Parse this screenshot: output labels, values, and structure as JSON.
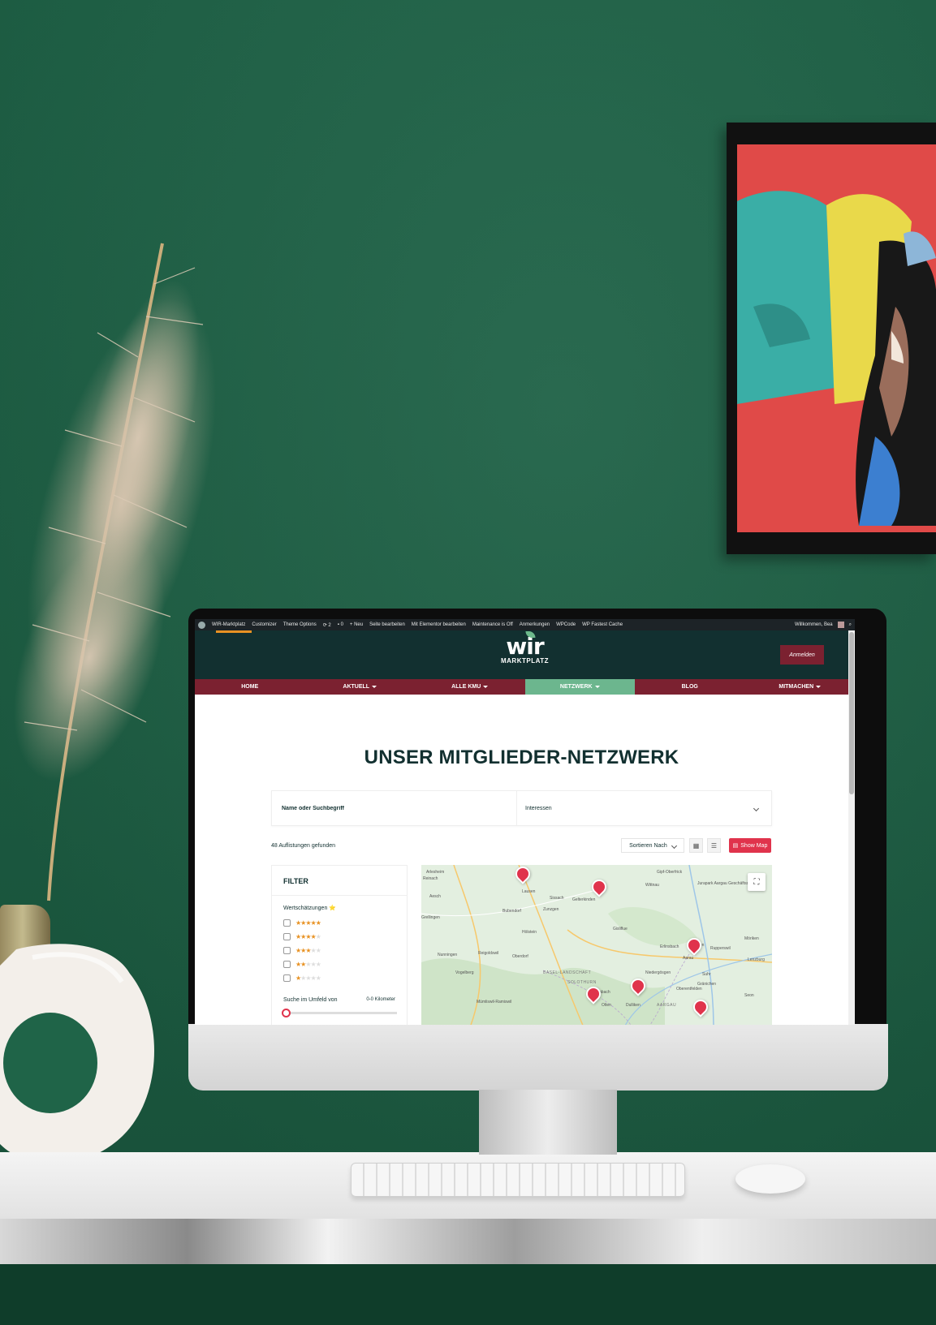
{
  "admin_bar": {
    "site": "WIR-Marktplatz",
    "items": [
      "Customizer",
      "Theme Options",
      "2",
      "0",
      "Neu",
      "Seite bearbeiten",
      "Mit Elementor bearbeiten",
      "Maintenance is Off",
      "Anmerkungen",
      "WPCode",
      "WP Fastest Cache"
    ],
    "greeting": "Willkommen, Bea"
  },
  "header": {
    "logo_word": "wir",
    "logo_sub": "MARKTPLATZ",
    "login_label": "Anmelden"
  },
  "nav": {
    "items": [
      {
        "label": "HOME",
        "dropdown": false
      },
      {
        "label": "AKTUELL",
        "dropdown": true
      },
      {
        "label": "ALLE KMU",
        "dropdown": true
      },
      {
        "label": "NETZWERK",
        "dropdown": true,
        "active": true
      },
      {
        "label": "BLOG",
        "dropdown": false
      },
      {
        "label": "MITMACHEN",
        "dropdown": true
      }
    ]
  },
  "page": {
    "title": "UNSER MITGLIEDER-NETZWERK",
    "search_placeholder": "Name oder Suchbegriff",
    "interests_label": "Interessen",
    "results_text": "48 Auflistungen gefunden",
    "sort_label": "Sortieren Nach",
    "show_map_label": "Show Map"
  },
  "filter": {
    "title": "FILTER",
    "ratings_label": "Wertschätzungen ⭐",
    "ratings": [
      5,
      4,
      3,
      2,
      1
    ],
    "radius_label": "Suche im Umfeld von",
    "radius_value": "0-0 Kilometer"
  },
  "map": {
    "places": [
      "Arlesheim",
      "Reinach",
      "Aesch",
      "Grellingen",
      "Bubendorf",
      "Zunzgen",
      "Lausen",
      "Sissach",
      "Gelterkinden",
      "Hölstein",
      "Gisliflue",
      "Wittnau",
      "Gipf-Oberfrick",
      "Jurapark Aargau Geschäftsstelle",
      "Erlinsbach",
      "Küttigen",
      "Aarau",
      "Rupperswil",
      "Nunningen",
      "Reigoldswil",
      "Oberdorf",
      "Vogelberg",
      "BASEL-LANDSCHAFT",
      "SOLOTHURN",
      "Trimbach",
      "Niedergösgen",
      "Olten",
      "Dulliken",
      "Suhr",
      "Oberentfelden",
      "Gränichen",
      "Mümliswil-Ramiswil",
      "AARGAU",
      "Seon",
      "Lenzburg",
      "Möriken"
    ],
    "marker_color": "#e0334c"
  },
  "colors": {
    "header_bg": "#123030",
    "nav_bg": "#7b2130",
    "nav_active": "#6cb68e",
    "accent": "#e0334c",
    "star": "#e89223",
    "wall": "#1f6448"
  }
}
